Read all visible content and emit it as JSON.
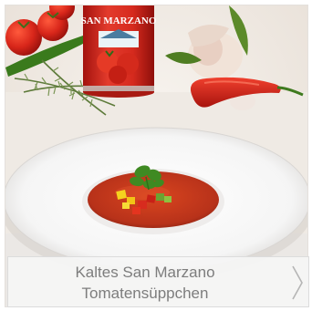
{
  "can": {
    "brand": "SAN MARZANO"
  },
  "caption": {
    "line1": "Kaltes San Marzano",
    "line2": "Tomatensüppchen"
  },
  "icons": {
    "next": "chevron-right-icon"
  },
  "colors": {
    "can_red": "#d92a1e",
    "soup": "#c83a1a",
    "caption_text": "#7d7d7d"
  }
}
